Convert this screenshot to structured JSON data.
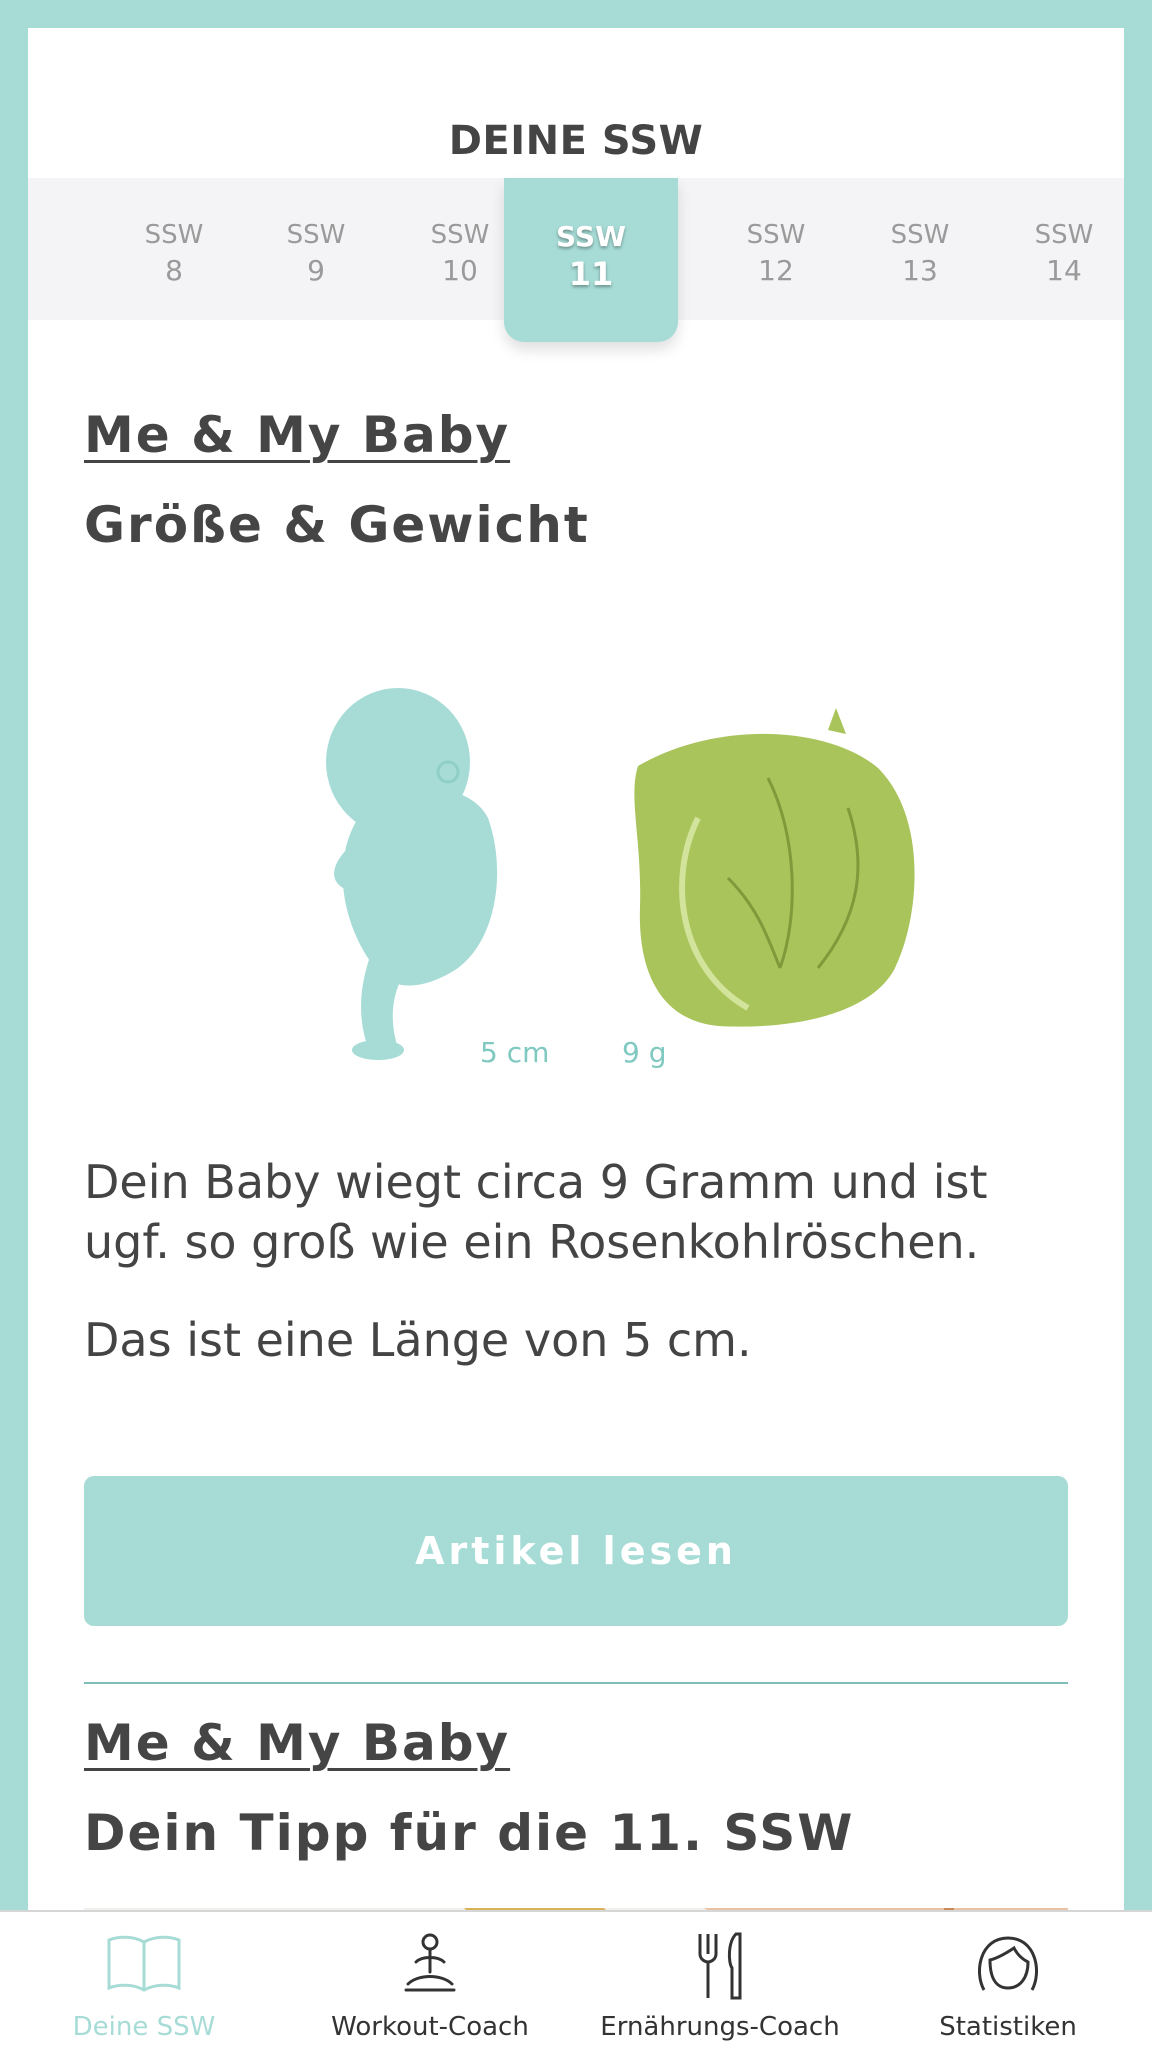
{
  "header": {
    "title": "DEINE SSW"
  },
  "weeks": [
    {
      "label": "SSW",
      "number": "8"
    },
    {
      "label": "SSW",
      "number": "9"
    },
    {
      "label": "SSW",
      "number": "10"
    },
    {
      "label": "SSW",
      "number": "11"
    },
    {
      "label": "SSW",
      "number": "12"
    },
    {
      "label": "SSW",
      "number": "13"
    },
    {
      "label": "SSW",
      "number": "14"
    }
  ],
  "active_week_index": 3,
  "section1": {
    "kicker": "Me & My Baby",
    "title": "Größe & Gewicht",
    "illustration": {
      "baby_icon": "fetus-illustration",
      "compare_icon": "brussels-sprout-illustration",
      "length": "5 cm",
      "weight": "9 g"
    },
    "paragraph1": "Dein Baby wiegt circa 9 Gramm und ist ugf. so groß wie ein Rosenkohlröschen.",
    "paragraph2": "Das ist eine Länge von 5 cm.",
    "button": "Artikel lesen"
  },
  "section2": {
    "kicker": "Me & My Baby",
    "title": "Dein Tipp für die 11. SSW"
  },
  "tabbar": [
    {
      "label": "Deine SSW",
      "icon": "open-book-icon",
      "active": true
    },
    {
      "label": "Workout-Coach",
      "icon": "meditation-icon",
      "active": false
    },
    {
      "label": "Ernährungs-Coach",
      "icon": "fork-knife-icon",
      "active": false
    },
    {
      "label": "Statistiken",
      "icon": "woman-face-icon",
      "active": false
    }
  ],
  "colors": {
    "accent": "#a7dcd6",
    "text": "#444444",
    "sprout": "#a9c45a"
  }
}
